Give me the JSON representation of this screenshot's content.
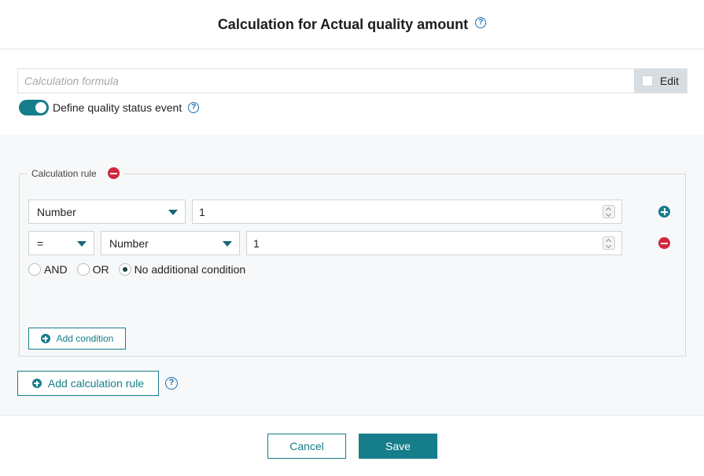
{
  "dialog": {
    "title": "Calculation for Actual quality amount",
    "help_icon": "question-circle-icon"
  },
  "formula": {
    "placeholder": "Calculation formula",
    "value": "",
    "edit_label": "Edit",
    "edit_checked": false
  },
  "quality_event": {
    "enabled": true,
    "label": "Define quality status event",
    "help_icon": "question-circle-icon"
  },
  "calculation_rule": {
    "legend": "Calculation rule",
    "remove_icon": "minus-circle-icon",
    "row1": {
      "type_select": "Number",
      "value": "1",
      "action_icon": "plus-circle-icon"
    },
    "row2": {
      "operator_select": "=",
      "type_select": "Number",
      "value": "1",
      "action_icon": "minus-circle-icon"
    },
    "conditions": {
      "options": [
        "AND",
        "OR",
        "No additional condition"
      ],
      "selected": "No additional condition"
    },
    "add_condition_label": "Add condition"
  },
  "add_rule": {
    "label": "Add calculation rule",
    "help_icon": "question-circle-icon"
  },
  "footer": {
    "cancel_label": "Cancel",
    "save_label": "Save"
  },
  "colors": {
    "accent": "#167d8a",
    "danger": "#d3263b",
    "help": "#1a6fb5"
  }
}
